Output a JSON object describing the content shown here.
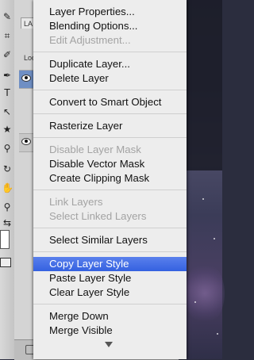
{
  "context_menu": {
    "groups": [
      [
        {
          "label": "Layer Properties...",
          "enabled": true
        },
        {
          "label": "Blending Options...",
          "enabled": true
        },
        {
          "label": "Edit Adjustment...",
          "enabled": false
        }
      ],
      [
        {
          "label": "Duplicate Layer...",
          "enabled": true
        },
        {
          "label": "Delete Layer",
          "enabled": true
        }
      ],
      [
        {
          "label": "Convert to Smart Object",
          "enabled": true
        }
      ],
      [
        {
          "label": "Rasterize Layer",
          "enabled": true
        }
      ],
      [
        {
          "label": "Disable Layer Mask",
          "enabled": false
        },
        {
          "label": "Disable Vector Mask",
          "enabled": true
        },
        {
          "label": "Create Clipping Mask",
          "enabled": true
        }
      ],
      [
        {
          "label": "Link Layers",
          "enabled": false
        },
        {
          "label": "Select Linked Layers",
          "enabled": false
        }
      ],
      [
        {
          "label": "Select Similar Layers",
          "enabled": true
        }
      ],
      [
        {
          "label": "Copy Layer Style",
          "enabled": true,
          "highlighted": true
        },
        {
          "label": "Paste Layer Style",
          "enabled": true
        },
        {
          "label": "Clear Layer Style",
          "enabled": true
        }
      ],
      [
        {
          "label": "Merge Down",
          "enabled": true
        },
        {
          "label": "Merge Visible",
          "enabled": true
        }
      ]
    ],
    "scroll_indicator": "chevron-down-icon"
  },
  "layers_panel": {
    "tab_label": "LA",
    "lock_label": "Loc"
  },
  "colors": {
    "highlight": "#3461e0",
    "menu_bg": "#ededed",
    "disabled_text": "#a3a3a3"
  }
}
